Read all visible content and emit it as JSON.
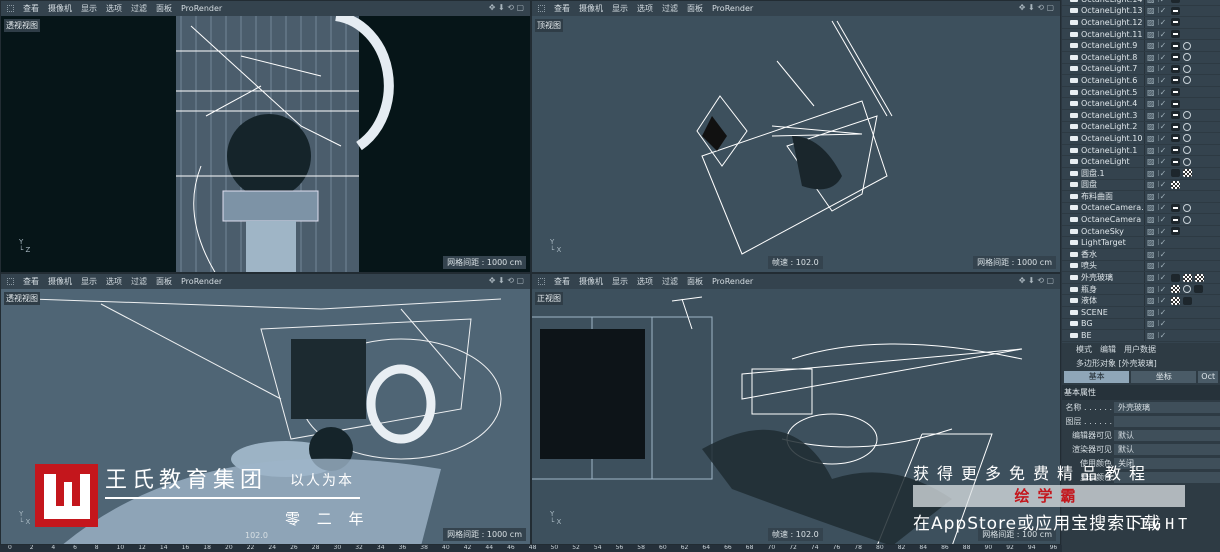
{
  "viewport_menu": [
    "查看",
    "摄像机",
    "显示",
    "选项",
    "过滤",
    "面板",
    "ProRender"
  ],
  "viewports": {
    "top_left": {
      "label": "透视视图",
      "grid": "网格间距 : 1000 cm"
    },
    "top_right": {
      "label": "顶视图",
      "fps": "帧速 : 102.0",
      "grid": "网格间距 : 1000 cm"
    },
    "bottom_left": {
      "label": "透视视图",
      "fps": "102.0",
      "grid": "网格间距 : 1000 cm"
    },
    "bottom_right": {
      "label": "正视图",
      "fps": "帧速 : 102.0",
      "grid": "网格间距 : 100 cm"
    }
  },
  "axis": {
    "y": "Y",
    "z": "Z",
    "x": "X"
  },
  "objects": [
    {
      "name": "OctaneLight.14",
      "tags": [
        "light"
      ]
    },
    {
      "name": "OctaneLight.13",
      "tags": [
        "light"
      ]
    },
    {
      "name": "OctaneLight.12",
      "tags": [
        "light"
      ]
    },
    {
      "name": "OctaneLight.11",
      "tags": [
        "light"
      ]
    },
    {
      "name": "OctaneLight.9",
      "tags": [
        "light",
        "target"
      ]
    },
    {
      "name": "OctaneLight.8",
      "tags": [
        "light",
        "target"
      ]
    },
    {
      "name": "OctaneLight.7",
      "tags": [
        "light",
        "target"
      ]
    },
    {
      "name": "OctaneLight.6",
      "tags": [
        "light",
        "target"
      ]
    },
    {
      "name": "OctaneLight.5",
      "tags": [
        "light"
      ]
    },
    {
      "name": "OctaneLight.4",
      "tags": [
        "light"
      ]
    },
    {
      "name": "OctaneLight.3",
      "tags": [
        "light",
        "target"
      ]
    },
    {
      "name": "OctaneLight.2",
      "tags": [
        "light",
        "target"
      ]
    },
    {
      "name": "OctaneLight.10",
      "tags": [
        "light",
        "target"
      ]
    },
    {
      "name": "OctaneLight.1",
      "tags": [
        "light",
        "target"
      ]
    },
    {
      "name": "OctaneLight",
      "tags": [
        "light",
        "target"
      ]
    },
    {
      "name": "圆盘.1",
      "tags": [
        "material",
        "checker"
      ]
    },
    {
      "name": "圆盘",
      "tags": [
        "checker"
      ]
    },
    {
      "name": "布料曲面",
      "tags": []
    },
    {
      "name": "OctaneCamera.1",
      "tags": [
        "camera",
        "target"
      ]
    },
    {
      "name": "OctaneCamera",
      "tags": [
        "camera",
        "target"
      ]
    },
    {
      "name": "OctaneSky",
      "tags": [
        "light"
      ]
    },
    {
      "name": "LightTarget",
      "tags": []
    },
    {
      "name": "香水",
      "tags": []
    },
    {
      "name": "喷头",
      "tags": []
    },
    {
      "name": "外壳玻璃",
      "tags": [
        "material",
        "checker",
        "checker"
      ]
    },
    {
      "name": "瓶身",
      "tags": [
        "checker",
        "target",
        "material"
      ]
    },
    {
      "name": "液体",
      "tags": [
        "checker",
        "material"
      ]
    },
    {
      "name": "SCENE",
      "tags": []
    },
    {
      "name": "BG",
      "tags": []
    },
    {
      "name": "BE",
      "tags": []
    }
  ],
  "attributes": {
    "menu": [
      "模式",
      "编辑",
      "用户数据"
    ],
    "title": "多边形对象 [外壳玻璃]",
    "tabs": [
      "基本",
      "坐标",
      "Oct"
    ],
    "section": "基本属性",
    "rows": [
      {
        "label": "名称 . . . . . .",
        "value": "外壳玻璃"
      },
      {
        "label": "图层 . . . . . .",
        "value": ""
      },
      {
        "label": "编辑器可见",
        "value": "默认"
      },
      {
        "label": "渲染器可见",
        "value": "默认"
      },
      {
        "label": "使用颜色",
        "value": "关闭"
      },
      {
        "label": "显示颜色",
        "value": ""
      }
    ]
  },
  "timeline": [
    "0",
    "2",
    "4",
    "6",
    "8",
    "10",
    "12",
    "14",
    "16",
    "18",
    "20",
    "22",
    "24",
    "26",
    "28",
    "30",
    "32",
    "34",
    "36",
    "38",
    "40",
    "42",
    "44",
    "46",
    "48",
    "50",
    "52",
    "54",
    "56",
    "58",
    "60",
    "62",
    "64",
    "66",
    "68",
    "70",
    "72",
    "74",
    "76",
    "78",
    "80",
    "82",
    "84",
    "86",
    "88",
    "90",
    "92",
    "94",
    "96"
  ],
  "watermark": {
    "brand": "王氏教育集团",
    "motto": "以人为本",
    "since": "零  二  年",
    "promo": "获得更多免费精品教程",
    "app": "绘学霸",
    "download": "在AppStore或应用宝搜索下载",
    "corner": "LIGHT",
    "logo_color": "#c4161c"
  }
}
